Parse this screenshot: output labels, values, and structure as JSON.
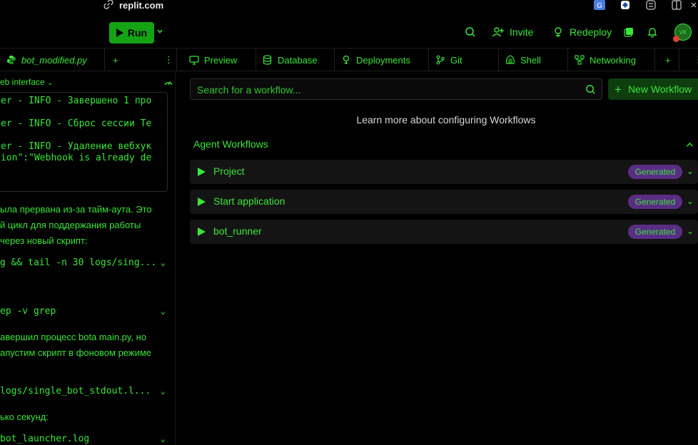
{
  "browser": {
    "url": "replit.com"
  },
  "topbar": {
    "run_label": "Run",
    "invite_label": "Invite",
    "redeploy_label": "Redeploy",
    "avatar_initials": "VK"
  },
  "editor": {
    "file_tab_label": "bot_modified.py",
    "add_tab": "+",
    "more": "⋮"
  },
  "tools": {
    "tabs": [
      {
        "label": "Preview"
      },
      {
        "label": "Database"
      },
      {
        "label": "Deployments"
      },
      {
        "label": "Git"
      },
      {
        "label": "Shell"
      },
      {
        "label": "Networking"
      }
    ],
    "add_tab": "+"
  },
  "left_panel": {
    "webview_label": "eb interface",
    "console_lines": [
      "er - INFO - Завершено 1 про",
      "er - INFO - Сброс сессии Те",
      "er - INFO - Удаление вебхук",
      "ion\":\"Webhook is already de"
    ],
    "paragraph1": [
      "ыла прервана из-за тайм-аута. Это",
      "й цикл для поддержания работы",
      "через новый скрипт:"
    ],
    "cmd1": "g && tail -n 30 logs/sing...",
    "cmd2": "ep -v grep",
    "paragraph2": [
      "авершил процесс bota main.py, но",
      "апустим скрипт в фоновом режиме"
    ],
    "cmd3": " logs/single_bot_stdout.l...",
    "paragraph3": "ько секунд:",
    "cmd4": "bot_launcher.log"
  },
  "workflows": {
    "search_placeholder": "Search for a workflow...",
    "new_workflow_label": "New Workflow",
    "learn_more": "Learn more about configuring Workflows",
    "section_title": "Agent Workflows",
    "items": [
      {
        "name": "Project",
        "badge": "Generated"
      },
      {
        "name": "Start application",
        "badge": "Generated"
      },
      {
        "name": "bot_runner",
        "badge": "Generated"
      }
    ]
  },
  "colors": {
    "accent": "#39e639",
    "run_button": "#15a315",
    "badge": "#5a2d85",
    "background": "#000000"
  }
}
